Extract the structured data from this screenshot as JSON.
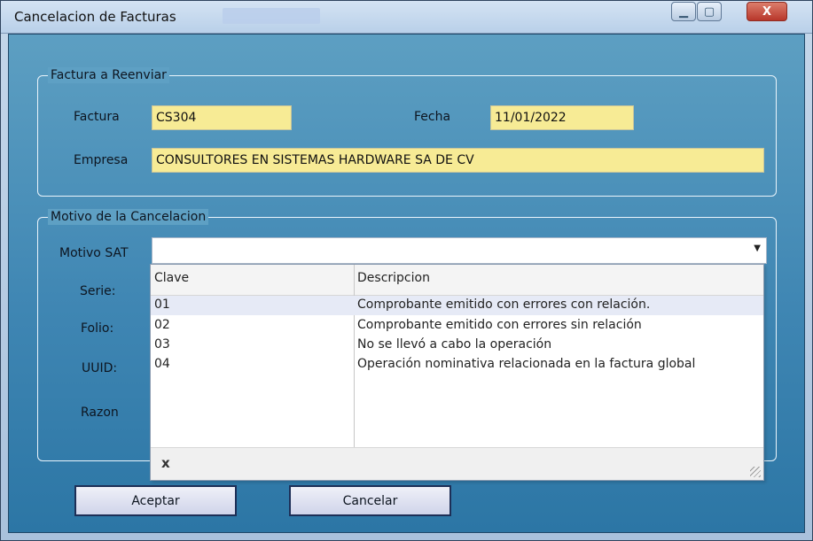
{
  "window": {
    "title": "Cancelacion de Facturas",
    "controls": {
      "minimize": "▁",
      "maximize": "▢",
      "close": "X"
    }
  },
  "factura_group": {
    "title": "Factura a Reenviar",
    "factura_label": "Factura",
    "factura_value": "CS304",
    "fecha_label": "Fecha",
    "fecha_value": "11/01/2022",
    "empresa_label": "Empresa",
    "empresa_value": "CONSULTORES EN SISTEMAS HARDWARE SA DE CV"
  },
  "motivo_group": {
    "title": "Motivo de la Cancelacion",
    "motivo_sat_label": "Motivo SAT",
    "motivo_sat_value": "",
    "serie_label": "Serie:",
    "folio_label": "Folio:",
    "uuid_label": "UUID:",
    "razon_label": "Razon"
  },
  "dropdown": {
    "columns": [
      "Clave",
      "Descripcion"
    ],
    "rows": [
      {
        "clave": "01",
        "descripcion": "Comprobante emitido con errores con relación."
      },
      {
        "clave": "02",
        "descripcion": "Comprobante emitido con errores sin relación"
      },
      {
        "clave": "03",
        "descripcion": "No se llevó a cabo la operación"
      },
      {
        "clave": "04",
        "descripcion": "Operación nominativa relacionada en la factura global"
      }
    ],
    "selected_index": 0,
    "clear_label": "x"
  },
  "buttons": {
    "accept": "Aceptar",
    "cancel": "Cancelar"
  }
}
